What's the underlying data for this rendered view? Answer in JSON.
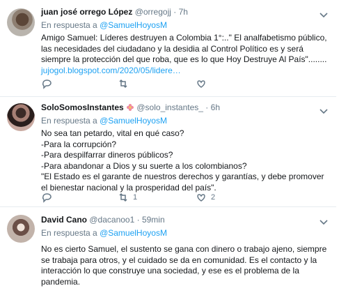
{
  "tweets": [
    {
      "name": "juan josé orrego López",
      "handle": "@orregojj",
      "time": "7h",
      "reply_prefix": "En respuesta a",
      "reply_to": "@SamuelHoyosM",
      "lines": [
        "Amigo Samuel: Líderes destruyen a Colombia 1°:..\" El analfabetismo público,",
        "las necesidades del ciudadano y la desidia al Control Político es y será",
        "siempre la protección del que roba, que es lo que Hoy Destruye Al País\"........"
      ],
      "link": "jujogol.blogspot.com/2020/05/lidere…",
      "retweets": "",
      "likes": ""
    },
    {
      "name": "SoloSomosInstantes",
      "handle": "@solo_instantes_",
      "time": "6h",
      "reply_prefix": "En respuesta a",
      "reply_to": "@SamuelHoyosM",
      "lines": [
        "No sea tan petardo, vital en qué caso?",
        "-Para la corrupción?",
        "-Para despilfarrar dineros públicos?",
        "-Para abandonar a Dios y su suerte a los colombianos?",
        "\"El Estado es el garante de nuestros derechos y garantías, y debe promover",
        "el bienestar nacional y la prosperidad del país\"."
      ],
      "retweets": "1",
      "likes": "2"
    },
    {
      "name": "David Cano",
      "handle": "@dacanoo1",
      "time": "59min",
      "reply_prefix": "En respuesta a",
      "reply_to": "@SamuelHoyosM",
      "lines": [
        "No es cierto Samuel, el sustento se gana con dinero o trabajo ajeno, siempre",
        "se trabaja para otros, y el cuidado se da en comunidad. Es el contacto y la",
        "interacción lo que construye una sociedad, y ese es el problema de la",
        "pandemia."
      ],
      "retweets": "",
      "likes": ""
    }
  ],
  "colors": {
    "accent": "#1da1f2",
    "secondary_text": "#657786",
    "divider": "#e6ecf0"
  },
  "icons": [
    "reply-icon",
    "retweet-icon",
    "like-icon",
    "share-icon",
    "chevron-down-icon",
    "flower-emoji-icon"
  ]
}
